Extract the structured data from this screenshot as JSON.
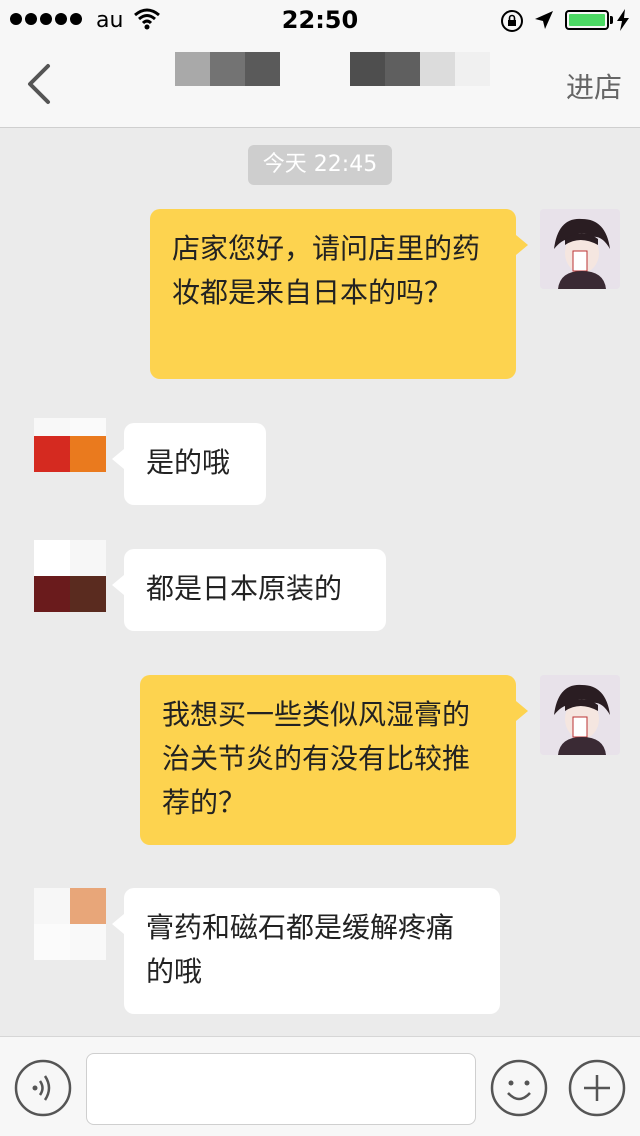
{
  "status_bar": {
    "carrier": "au",
    "time": "22:50",
    "battery_level": 1.0,
    "icons": [
      "signal-icon",
      "wifi-icon",
      "rotation-lock-icon",
      "location-icon",
      "battery-icon",
      "charging-icon"
    ]
  },
  "nav": {
    "title": "",
    "enter_store": "进店",
    "icons": [
      "back-chevron-icon"
    ]
  },
  "chat": {
    "timestamp": "今天 22:45",
    "messages": [
      {
        "side": "out",
        "text": "店家您好，请问店里的药妆都是来自日本的吗？"
      },
      {
        "side": "in",
        "text": "是的哦"
      },
      {
        "side": "in",
        "text": "都是日本原装的"
      },
      {
        "side": "out",
        "text": "我想买一些类似风湿膏的治关节炎的有没有比较推荐的？"
      },
      {
        "side": "in",
        "text": "膏药和磁石都是缓解疼痛的哦"
      }
    ]
  },
  "input_bar": {
    "placeholder": "",
    "icons": [
      "voice-icon",
      "emoji-icon",
      "plus-icon"
    ]
  },
  "colors": {
    "outgoing_bubble": "#fdd34f",
    "incoming_bubble": "#ffffff",
    "background": "#ebebeb",
    "battery": "#4cd964"
  }
}
